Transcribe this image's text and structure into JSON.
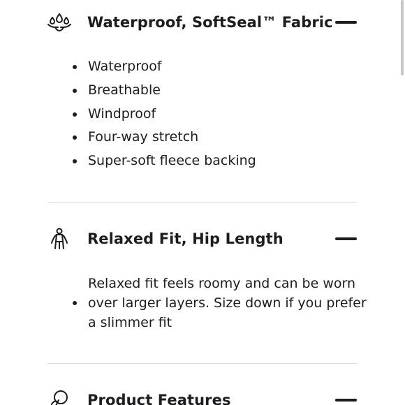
{
  "sections": [
    {
      "title": "Waterproof, SoftSeal™ Fabric",
      "icon": "water-drops-hand-icon",
      "expanded": true,
      "items": [
        "Waterproof",
        "Breathable",
        "Windproof",
        "Four-way stretch",
        "Super-soft fleece backing"
      ]
    },
    {
      "title": "Relaxed Fit, Hip Length",
      "icon": "person-figure-icon",
      "expanded": true,
      "paragraph": "Relaxed fit feels roomy and can be worn over larger layers. Size down if you prefer a slimmer fit"
    },
    {
      "title": "Product Features",
      "icon": "leaf-circle-icon",
      "expanded": true
    }
  ],
  "colors": {
    "text": "#1d1d1f",
    "divider": "#d9d9d9",
    "scrollbar": "#c7c7c7"
  }
}
